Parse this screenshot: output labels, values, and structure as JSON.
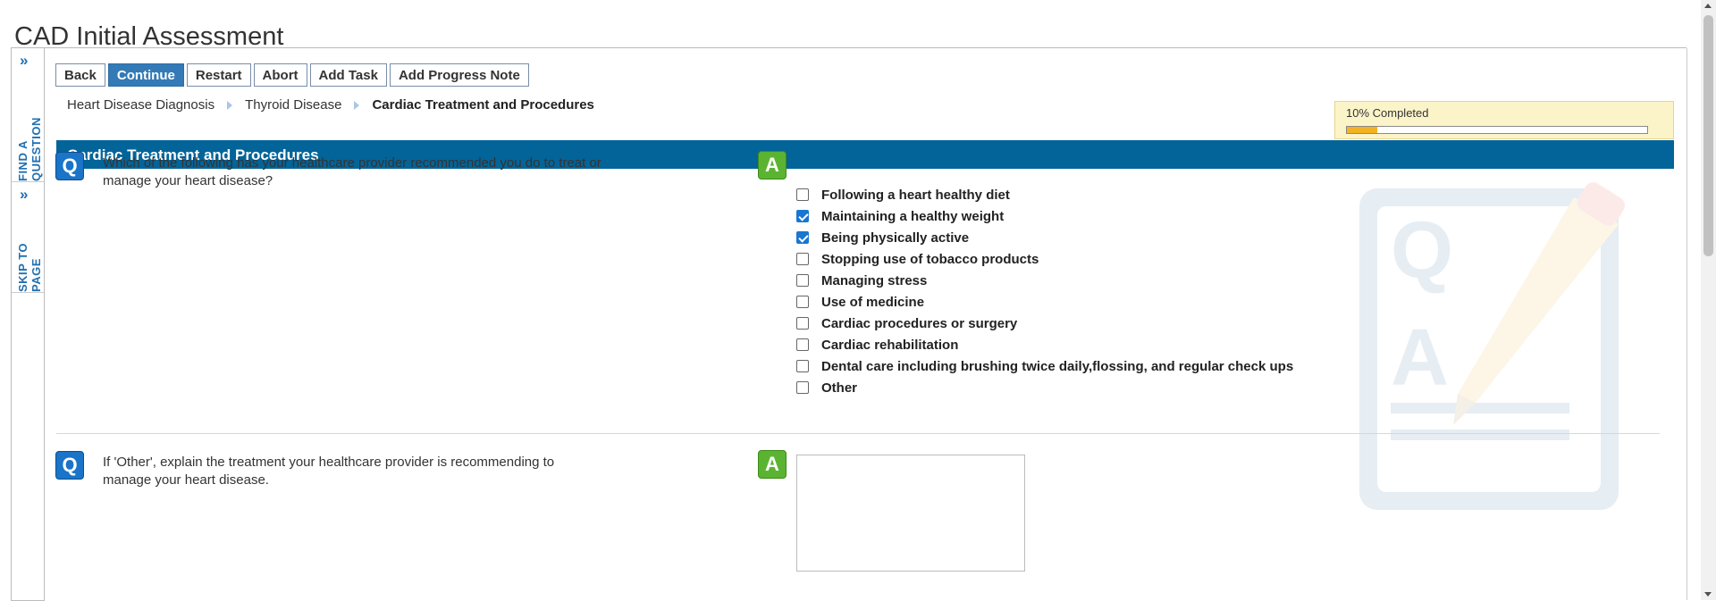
{
  "page": {
    "title": "CAD Initial Assessment"
  },
  "side_tabs": [
    {
      "label": "FIND A QUESTION",
      "icon": "chevrons-right-icon"
    },
    {
      "label": "SKIP TO PAGE",
      "icon": "chevrons-right-icon"
    }
  ],
  "toolbar": {
    "back": "Back",
    "continue": "Continue",
    "restart": "Restart",
    "abort": "Abort",
    "add_task": "Add Task",
    "add_progress_note": "Add Progress Note"
  },
  "breadcrumb": [
    "Heart Disease Diagnosis",
    "Thyroid Disease",
    "Cardiac Treatment and Procedures"
  ],
  "progress": {
    "label": "10% Completed",
    "fraction": 0.1
  },
  "section": {
    "title": "Cardiac Treatment and Procedures"
  },
  "icons": {
    "question": "Q",
    "answer": "A"
  },
  "questions": [
    {
      "text": "Which of the following has your healthcare provider recommended you do to treat or manage your heart disease?",
      "options": [
        {
          "label": "Following a heart healthy diet",
          "checked": false
        },
        {
          "label": "Maintaining a healthy weight",
          "checked": true
        },
        {
          "label": "Being physically active",
          "checked": true
        },
        {
          "label": "Stopping use of tobacco products",
          "checked": false
        },
        {
          "label": "Managing stress",
          "checked": false
        },
        {
          "label": "Use of medicine",
          "checked": false
        },
        {
          "label": "Cardiac procedures or surgery",
          "checked": false
        },
        {
          "label": "Cardiac rehabilitation",
          "checked": false
        },
        {
          "label": "Dental care including brushing twice daily,flossing, and regular check ups",
          "checked": false
        },
        {
          "label": "Other",
          "checked": false
        }
      ]
    },
    {
      "text": "If 'Other', explain the treatment your healthcare provider is recommending to manage your heart disease.",
      "answer_value": ""
    }
  ],
  "colors": {
    "header": "#036499",
    "primary_button": "#337ab7",
    "progress_fill": "#f3b221",
    "question_icon": "#1a74c8",
    "answer_icon": "#5bb431"
  }
}
